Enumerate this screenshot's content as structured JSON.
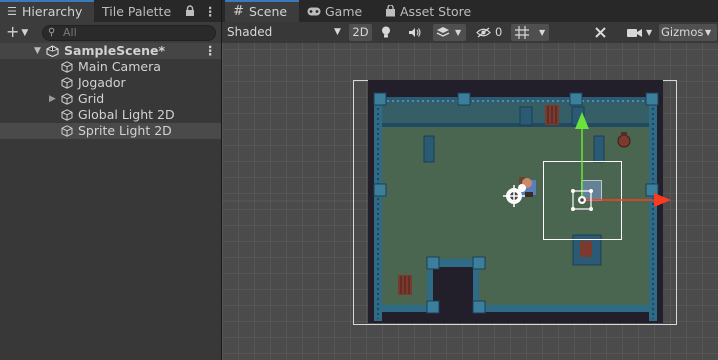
{
  "hierarchy": {
    "tabs": [
      {
        "label": "Hierarchy",
        "icon": "list-icon",
        "active": true
      },
      {
        "label": "Tile Palette",
        "active": false
      }
    ],
    "search": {
      "placeholder": "All"
    },
    "scene": {
      "name": "SampleScene*"
    },
    "items": [
      {
        "label": "Main Camera",
        "icon": "gameobject-cube-icon",
        "expandable": false,
        "selected": false
      },
      {
        "label": "Jogador",
        "icon": "gameobject-cube-icon",
        "expandable": false,
        "selected": false
      },
      {
        "label": "Grid",
        "icon": "gameobject-cube-icon",
        "expandable": true,
        "selected": false
      },
      {
        "label": "Global Light 2D",
        "icon": "gameobject-cube-icon",
        "expandable": false,
        "selected": false
      },
      {
        "label": "Sprite Light 2D",
        "icon": "gameobject-cube-icon",
        "expandable": false,
        "selected": true
      }
    ]
  },
  "scene_view": {
    "tabs": [
      {
        "label": "Scene",
        "icon": "grid-icon",
        "active": true
      },
      {
        "label": "Game",
        "icon": "gamepad-icon",
        "active": false
      },
      {
        "label": "Asset Store",
        "icon": "shopping-bag-icon",
        "active": false
      }
    ],
    "toolbar": {
      "shading_mode": "Shaded",
      "mode_2d": "2D",
      "hidden_count": "0",
      "gizmos": "Gizmos"
    }
  },
  "colors": {
    "accent": "#3a79bb",
    "panel_bg": "#383838",
    "viewport_bg": "#4b4b4b",
    "floor": "#4a6650",
    "wall": "#2f6b86",
    "transform_x": "#ff3b1f",
    "transform_y": "#6ae23a"
  }
}
